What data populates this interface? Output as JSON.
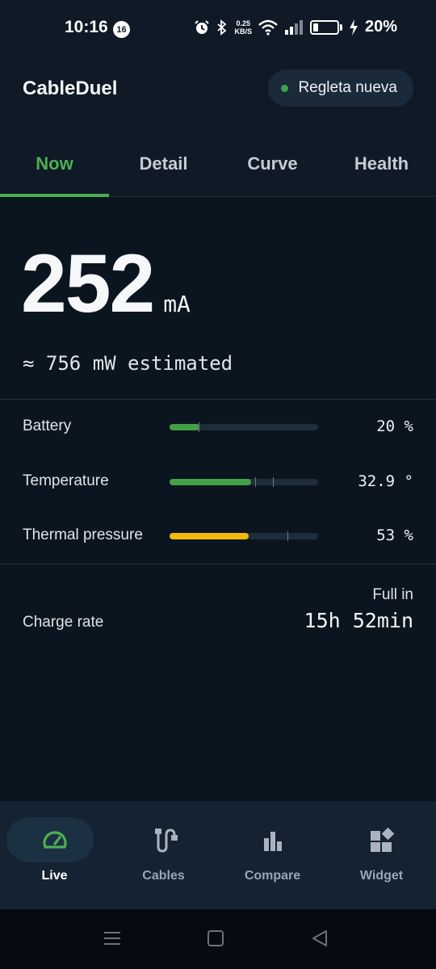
{
  "status_bar": {
    "time": "10:16",
    "notification_count": "16",
    "net_speed_value": "0.25",
    "net_speed_unit": "KB/S",
    "battery_percent": "20%",
    "battery_level": 0.2
  },
  "app": {
    "title": "CableDuel",
    "device_chip": {
      "label": "Regleta nueva",
      "status_color": "#43a047"
    }
  },
  "tabs": [
    {
      "label": "Now",
      "active": true
    },
    {
      "label": "Detail",
      "active": false
    },
    {
      "label": "Curve",
      "active": false
    },
    {
      "label": "Health",
      "active": false
    }
  ],
  "reading": {
    "value": "252",
    "unit": "mA",
    "estimated": "≈ 756 mW estimated"
  },
  "metrics": [
    {
      "label": "Battery",
      "value": "20 %",
      "level": 0.2,
      "color": "#43a047"
    },
    {
      "label": "Temperature",
      "value": "32.9 °",
      "level": 0.55,
      "color": "#43a047"
    },
    {
      "label": "Thermal pressure",
      "value": "53 %",
      "level": 0.53,
      "color": "#f5b90a"
    }
  ],
  "charge": {
    "label": "Charge rate",
    "full_in_label": "Full in",
    "full_in_value": "15h 52min"
  },
  "bottom_nav": [
    {
      "label": "Live",
      "icon": "speedometer-icon",
      "active": true
    },
    {
      "label": "Cables",
      "icon": "cable-icon",
      "active": false
    },
    {
      "label": "Compare",
      "icon": "bar-chart-icon",
      "active": false
    },
    {
      "label": "Widget",
      "icon": "widgets-icon",
      "active": false
    }
  ],
  "colors": {
    "accent": "#4caf50",
    "warning": "#f5b90a",
    "background": "#0b1520"
  }
}
